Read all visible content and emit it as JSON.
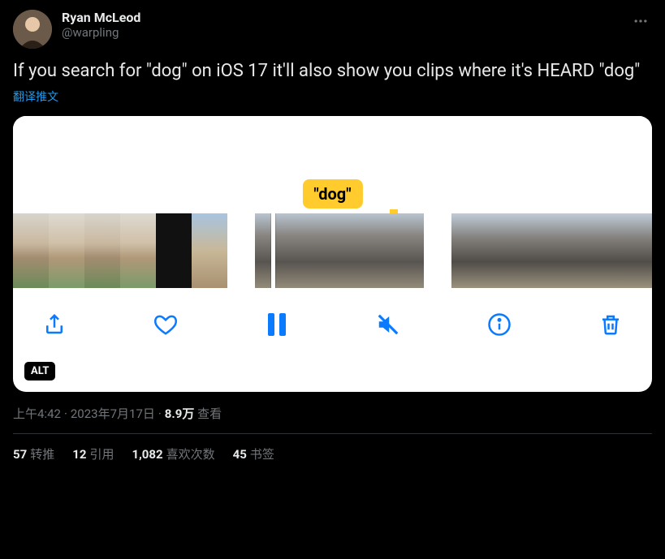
{
  "user": {
    "display_name": "Ryan McLeod",
    "handle": "@warpling"
  },
  "tweet_text": "If you search for \"dog\" on iOS 17 it'll also show you clips where it's HEARD \"dog\"",
  "translate_label": "翻译推文",
  "media": {
    "highlight_label": "\"dog\"",
    "alt_badge": "ALT",
    "toolbar": {
      "share": "share",
      "like": "like",
      "pause": "pause",
      "mute": "mute",
      "info": "info",
      "delete": "delete"
    }
  },
  "meta": {
    "time": "上午4:42",
    "date": "2023年7月17日",
    "views_number": "8.9万",
    "views_label": "查看"
  },
  "stats": {
    "retweets": {
      "count": "57",
      "label": "转推"
    },
    "quotes": {
      "count": "12",
      "label": "引用"
    },
    "likes": {
      "count": "1,082",
      "label": "喜欢次数"
    },
    "bookmarks": {
      "count": "45",
      "label": "书签"
    }
  }
}
